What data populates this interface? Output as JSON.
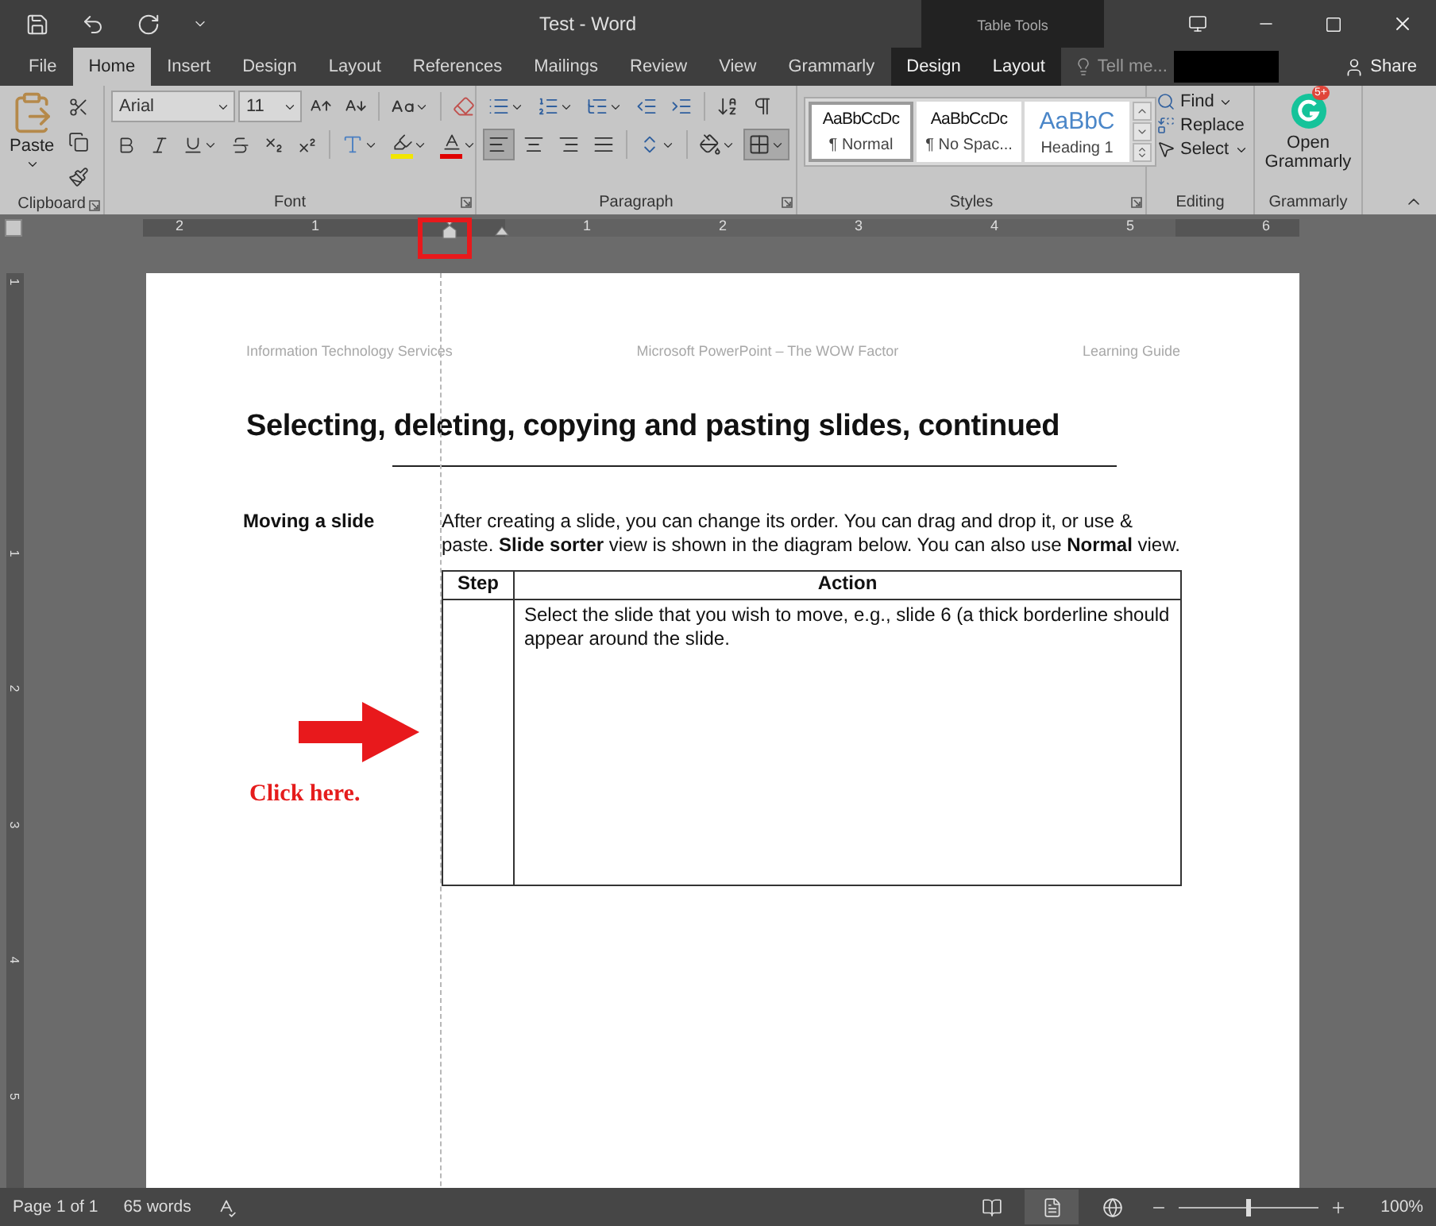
{
  "window": {
    "title": "Test - Word",
    "contextual_title": "Table Tools"
  },
  "tabs": [
    {
      "label": "File",
      "selected": false,
      "contextual": false
    },
    {
      "label": "Home",
      "selected": true,
      "contextual": false
    },
    {
      "label": "Insert",
      "selected": false,
      "contextual": false
    },
    {
      "label": "Design",
      "selected": false,
      "contextual": false
    },
    {
      "label": "Layout",
      "selected": false,
      "contextual": false
    },
    {
      "label": "References",
      "selected": false,
      "contextual": false
    },
    {
      "label": "Mailings",
      "selected": false,
      "contextual": false
    },
    {
      "label": "Review",
      "selected": false,
      "contextual": false
    },
    {
      "label": "View",
      "selected": false,
      "contextual": false
    },
    {
      "label": "Grammarly",
      "selected": false,
      "contextual": false
    },
    {
      "label": "Design",
      "selected": false,
      "contextual": true
    },
    {
      "label": "Layout",
      "selected": false,
      "contextual": true
    }
  ],
  "tell_me": {
    "placeholder": "Tell me..."
  },
  "share": {
    "label": "Share"
  },
  "ribbon": {
    "clipboard": {
      "label": "Clipboard",
      "paste": "Paste"
    },
    "font": {
      "label": "Font",
      "font_name": "Arial",
      "font_size": "11"
    },
    "paragraph": {
      "label": "Paragraph",
      "alignments": [
        {
          "kind": "left",
          "selected": true
        },
        {
          "kind": "center",
          "selected": false
        },
        {
          "kind": "right",
          "selected": false
        },
        {
          "kind": "justify",
          "selected": false
        }
      ]
    },
    "styles": {
      "label": "Styles",
      "items": [
        {
          "preview": "AaBbCcDc",
          "name": "¶ Normal",
          "kind": "body",
          "selected": true
        },
        {
          "preview": "AaBbCcDc",
          "name": "¶ No Spac...",
          "kind": "body",
          "selected": false
        },
        {
          "preview": "AaBbC",
          "name": "Heading 1",
          "kind": "heading",
          "selected": false
        }
      ]
    },
    "editing": {
      "label": "Editing",
      "find": "Find",
      "replace": "Replace",
      "select": "Select"
    },
    "grammarly": {
      "label": "Grammarly",
      "button": "Open Grammarly",
      "badge": "5+"
    }
  },
  "horizontal_ruler": {
    "left_labels": [
      "2",
      "1"
    ],
    "right_labels": [
      "1",
      "2",
      "3",
      "4",
      "5",
      "6"
    ]
  },
  "vertical_ruler": {
    "top_labels": [
      "1"
    ],
    "labels": [
      "1",
      "2",
      "3",
      "4",
      "5"
    ]
  },
  "document": {
    "header": [
      "Information Technology Services",
      "Microsoft PowerPoint – The WOW Factor",
      "Learning Guide"
    ],
    "heading": "Selecting, deleting, copying and pasting slides, continued",
    "section_label": "Moving a slide",
    "paragraph": "After creating a slide, you can change its order. You can drag and drop it, or use & paste. **Slide sorter** view is shown in the diagram below. You can also use **Normal** view.",
    "table": {
      "columns": [
        "Step",
        "Action"
      ],
      "rows": [
        {
          "action": "Select the slide that you wish to move, e.g., slide 6 (a thick borderline should appear around the slide."
        }
      ]
    }
  },
  "annotation": {
    "text": "Click here."
  },
  "status_bar": {
    "page": "Page 1 of 1",
    "words": "65 words",
    "views": [
      {
        "kind": "read",
        "selected": false
      },
      {
        "kind": "print",
        "selected": true
      },
      {
        "kind": "web",
        "selected": false
      }
    ],
    "zoom_slider": {
      "level": 0.5
    },
    "zoom": "100%"
  }
}
